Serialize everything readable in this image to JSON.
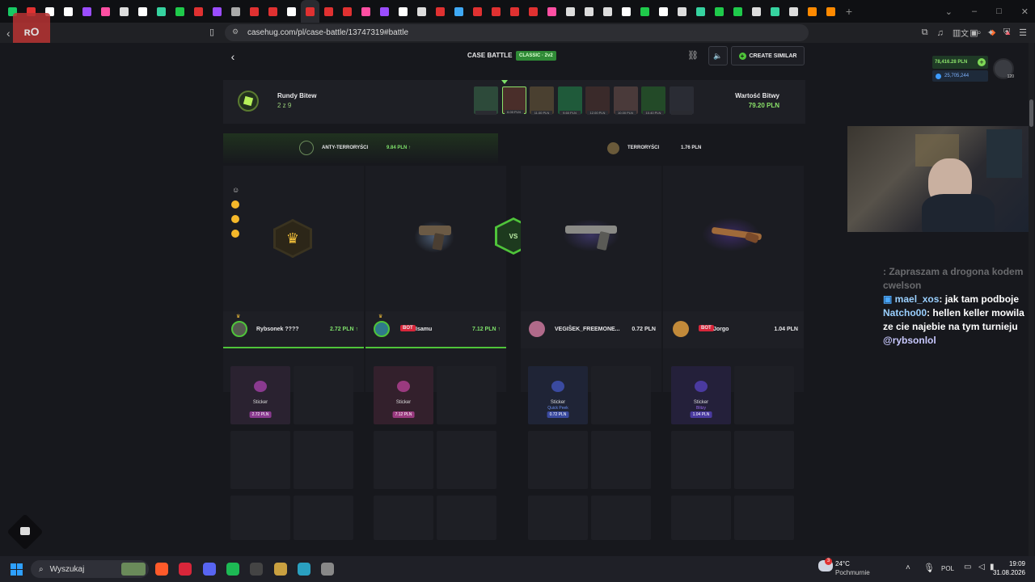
{
  "browser": {
    "tab_colors": [
      "#18c964",
      "#e03131",
      "#ffffff",
      "#ffffff",
      "#9b4dff",
      "#ff4fa3",
      "#dddddd",
      "#ffffff",
      "#36d3a0",
      "#1fca4b",
      "#e03131",
      "#9b4dff",
      "#aaaaaa",
      "#e03131",
      "#e03131",
      "#ffffff",
      "#e03131",
      "#e03131",
      "#e03131",
      "#ff4fa3",
      "#9b4dff",
      "#ffffff",
      "#dddddd",
      "#e03131",
      "#3fa9f5",
      "#e03131",
      "#e03131",
      "#e03131",
      "#e03131",
      "#ff4fa3",
      "#dddddd",
      "#dddddd",
      "#dddddd",
      "#ffffff",
      "#1fca4b",
      "#ffffff",
      "#dddddd",
      "#36d3a0",
      "#1fca4b",
      "#1fca4b",
      "#dddddd",
      "#36d3a0",
      "#dddddd",
      "#ff8a00",
      "#ff8a00"
    ],
    "active_tab_index": 16,
    "url": "casehug.com/pl/case-battle/13747319#battle",
    "new_tab": "+"
  },
  "header": {
    "back": "‹",
    "title": "CASE BATTLE",
    "mode_badge": "CLASSIC · 2v2",
    "create_similar": "CREATE SIMILAR"
  },
  "wallet": {
    "balance": "78,416.28 PLN",
    "points": "25,705,244",
    "level": "120"
  },
  "rounds": {
    "label": "Rundy Bitew",
    "count": "2 z 9",
    "value_label": "Wartość Bitwy",
    "value": "79.20 PLN",
    "cases": [
      {
        "price": "",
        "color": "#2d4a3a"
      },
      {
        "price": "6.00 PLN",
        "color": "#4a2e2a"
      },
      {
        "price": "11.00 PLN",
        "color": "#4a4030"
      },
      {
        "price": "9.60 PLN",
        "color": "#1f5a3a"
      },
      {
        "price": "12.00 PLN",
        "color": "#3a2a2a"
      },
      {
        "price": "10.00 PLN",
        "color": "#4a3a3a"
      },
      {
        "price": "10.40 PLN",
        "color": "#234a28"
      },
      {
        "price": "",
        "color": "#2a2c34"
      }
    ]
  },
  "teams": {
    "ct": {
      "name": "ANTY-TERRORYŚCI",
      "total": "9.84 PLN ↑"
    },
    "t": {
      "name": "TERRORYŚCI",
      "total": "1.76 PLN"
    }
  },
  "vs": "VS",
  "players": [
    {
      "name": "Rybsonek ????",
      "bot": "",
      "value": "2.72 PLN ↑",
      "value_color": "#7ee06a",
      "avatar": "#555a50"
    },
    {
      "name": "Isamu",
      "bot": "BOT",
      "value": "7.12 PLN ↑",
      "value_color": "#7ee06a",
      "avatar": "#2f7a8a"
    },
    {
      "name": "VEGIŠEK_FREEMONE...",
      "bot": "",
      "value": "0.72 PLN",
      "value_color": "#e8e8ea",
      "avatar": "#b06a8a"
    },
    {
      "name": "Jorgo",
      "bot": "BOT",
      "value": "1.04 PLN",
      "value_color": "#e8e8ea",
      "avatar": "#c28a3a"
    }
  ],
  "drops": [
    {
      "name": "Sticker",
      "sub": "",
      "price": "2.72 PLN",
      "sub_color": "#d86bd0",
      "price_bg": "#8a3a8f",
      "bg": "#2a2230"
    },
    {
      "name": "Sticker",
      "sub": "",
      "price": "7.12 PLN",
      "sub_color": "#e05a9a",
      "price_bg": "#9a3a7f",
      "bg": "#33202c"
    },
    {
      "name": "Sticker",
      "sub": "Quick Peek",
      "price": "0.72 PLN",
      "sub_color": "#6a8ef0",
      "price_bg": "#3a4aa0",
      "bg": "#1f2436"
    },
    {
      "name": "Sticker",
      "sub": "Blitzy",
      "price": "1.04 PLN",
      "sub_color": "#9a6af0",
      "price_bg": "#4a3aa0",
      "bg": "#24203a"
    }
  ],
  "chat": [
    {
      "user": "",
      "text": ": Zapraszam a drogona kodem cwelson",
      "user_color": "#ff5a5a",
      "dim": true
    },
    {
      "user": "mael_xos",
      "text": ": jak tam podboje",
      "user_color": "#9ad0ff",
      "dim": false
    },
    {
      "user": "Natcho00",
      "text": ": hellen keller mowila ze cie najebie na tym turnieju",
      "user_color": "#9ad0ff",
      "dim": false
    },
    {
      "user": "@rybsonlol",
      "text": "",
      "user_color": "#c9c9ff",
      "dim": false
    }
  ],
  "taskbar": {
    "search": "Wyszukaj",
    "weather_temp": "24°C",
    "weather_desc": "Pochmurnie",
    "lang": "POL",
    "time": "19:09",
    "date": "31.08.2026",
    "notif": "3"
  }
}
